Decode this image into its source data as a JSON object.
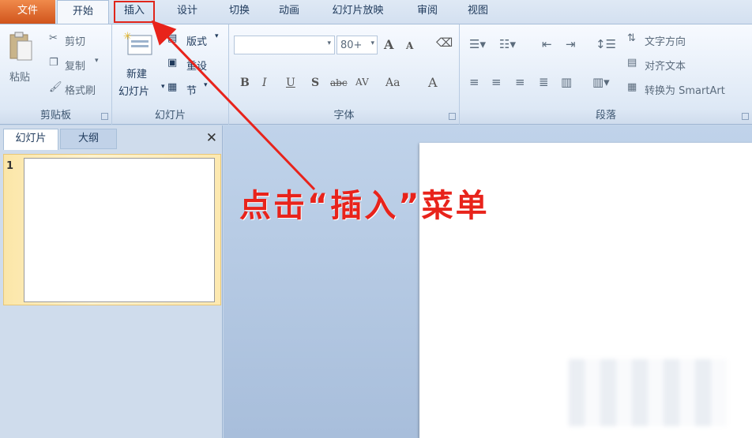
{
  "tabs": {
    "file": "文件",
    "home": "开始",
    "insert": "插入",
    "design": "设计",
    "transitions": "切换",
    "animations": "动画",
    "slideshow": "幻灯片放映",
    "review": "审阅",
    "view": "视图"
  },
  "clipboard": {
    "paste": "粘贴",
    "cut": "剪切",
    "copy": "复制",
    "format_painter": "格式刷",
    "group_label": "剪贴板"
  },
  "slides": {
    "new_slide_line1": "新建",
    "new_slide_line2": "幻灯片",
    "layout": "版式",
    "reset": "重设",
    "section": "节",
    "group_label": "幻灯片"
  },
  "font": {
    "font_name": "",
    "font_size": "80+",
    "bold": "B",
    "italic": "I",
    "underline": "U",
    "shadow": "S",
    "strikethrough": "abc",
    "spacing": "AV",
    "case": "Aa",
    "color": "A",
    "grow": "A",
    "shrink": "A",
    "group_label": "字体"
  },
  "paragraph": {
    "text_direction": "文字方向",
    "align_text": "对齐文本",
    "smartart": "转换为 SmartArt",
    "group_label": "段落"
  },
  "pane": {
    "slides_tab": "幻灯片",
    "outline_tab": "大纲",
    "close": "✕",
    "slide_number": "1"
  },
  "annotation": {
    "text": "点击“插入”菜单"
  },
  "colors": {
    "accent_red": "#e8231b",
    "file_tab": "#d0541c"
  }
}
